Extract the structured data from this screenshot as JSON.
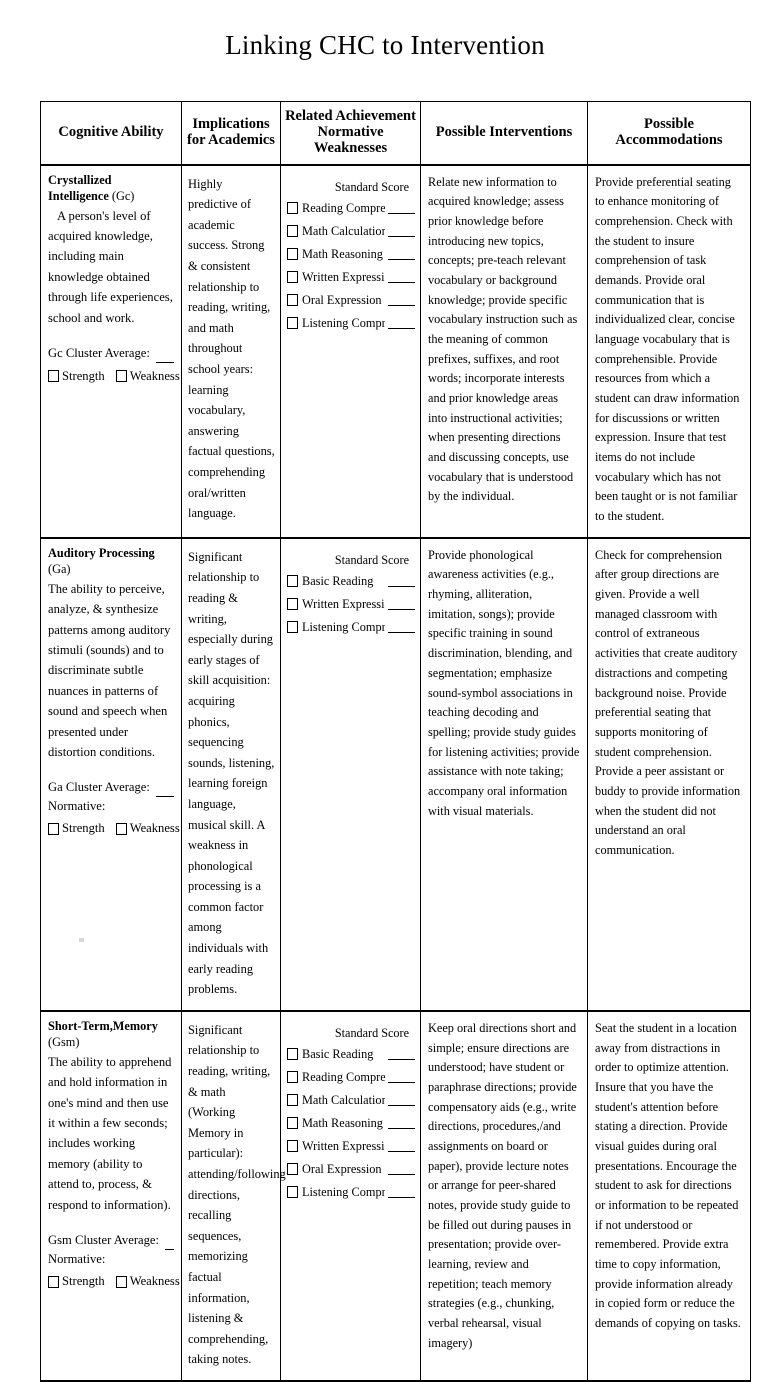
{
  "document": {
    "title": "Linking CHC to Intervention"
  },
  "table": {
    "headers": [
      "Cognitive Ability",
      "Implications\nfor Academics",
      "Related Achievement\nNormative Weaknesses",
      "Possible Interventions",
      "Possible Accommodations"
    ],
    "header_lines": {
      "h1": "Cognitive Ability",
      "h2a": "Implications",
      "h2b": "for Academics",
      "h3a": "Related Achievement",
      "h3b": "Normative Weaknesses",
      "h4": "Possible Interventions",
      "h5": "Possible Accommodations"
    },
    "standard_score_label": "Standard Score",
    "strength_label": "Strength",
    "weakness_label": "Weakness",
    "normative_label": "Normative:",
    "rows": [
      {
        "ability": {
          "name": "Crystallized Intelligence",
          "code": "(Gc)",
          "description": "A person's level of acquired knowledge, including main knowledge obtained through life experiences, school and work.",
          "cluster_label": "Gc Cluster Average:",
          "has_normative_label": false
        },
        "implications": "Highly predictive of academic success. Strong & consistent relationship to reading, writing, and math throughout school years: learning vocabulary, answering factual questions, comprehending oral/written language.",
        "achievement_areas": [
          "Reading Comprehension",
          "Math Calculations",
          "Math Reasoning",
          "Written Expression",
          "Oral Expression",
          "Listening Comprehension"
        ],
        "interventions": "Relate new information to acquired knowledge; assess prior knowledge before introducing new topics, concepts; pre-teach relevant vocabulary or background knowledge; provide specific vocabulary instruction such as the meaning of common prefixes, suffixes, and root words; incorporate interests and prior knowledge areas into instructional activities; when presenting directions and discussing concepts, use vocabulary that is understood by the individual.",
        "accommodations": "Provide preferential seating to enhance monitoring of comprehension. Check with the student to insure comprehension of task demands. Provide oral communication that is individualized clear, concise language vocabulary that is comprehensible. Provide resources from which a student can draw information for discussions or written expression. Insure that test items do not include vocabulary which has not been taught or is not familiar to the student."
      },
      {
        "ability": {
          "name": "Auditory Processing",
          "code": "(Ga)",
          "description": "The ability to perceive, analyze, & synthesize patterns among auditory stimuli (sounds) and to discriminate subtle nuances in patterns of sound and speech when presented under distortion conditions.",
          "cluster_label": "Ga Cluster Average:",
          "has_normative_label": true
        },
        "implications": "Significant relationship to reading & writing, especially during early stages of skill acquisition: acquiring phonics, sequencing sounds, listening, learning foreign language, musical skill. A weakness in phonological processing is a common factor among individuals with early reading problems.",
        "achievement_areas": [
          "Basic Reading",
          "Written Expression",
          "Listening Comprehension"
        ],
        "interventions": "Provide phonological awareness activities (e.g., rhyming, alliteration, imitation, songs); provide specific training in sound discrimination, blending, and segmentation; emphasize sound-symbol associations in teaching decoding and spelling; provide study guides for listening activities; provide assistance with note taking; accompany oral information with visual materials.",
        "accommodations": "Check for comprehension after group directions are given. Provide a well managed classroom with control of extraneous activities that create auditory distractions and competing background noise. Provide preferential seating that supports monitoring of student comprehension. Provide a peer assistant or buddy to provide information when the student did not understand an oral communication."
      },
      {
        "ability": {
          "name": "Short-Term,Memory",
          "code": "(Gsm)",
          "description": "The ability to apprehend and hold information in one's mind and then use it within a few seconds; includes working memory (ability to attend to, process, & respond to information).",
          "cluster_label": "Gsm Cluster Average:",
          "has_normative_label": true
        },
        "implications": "Significant relationship to reading, writing, & math (Working Memory in particular): attending/following directions, recalling sequences, memorizing factual information, listening & comprehending, taking notes.",
        "achievement_areas": [
          "Basic Reading",
          "Reading Comprehension",
          "Math Calculations",
          "Math Reasoning",
          "Written Expression",
          "Oral Expression",
          "Listening Comprehension"
        ],
        "interventions": "Keep oral directions short and simple; ensure directions are understood; have student or paraphrase directions; provide compensatory aids (e.g., write directions, procedures,/and assignments on board or paper), provide lecture notes or arrange for peer-shared notes, provide study guide to be filled out during pauses in presentation; provide over-learning, review and repetition; teach memory strategies (e.g., chunking, verbal rehearsal, visual imagery)",
        "accommodations": "Seat the student in a location away from distractions in order to optimize attention. Insure that you have the student's attention before stating a direction. Provide visual guides during oral presentations. Encourage the student to ask for directions or information to be repeated if not understood or remembered. Provide extra time to copy information, provide information already in copied form or reduce the demands of copying on tasks."
      }
    ]
  }
}
